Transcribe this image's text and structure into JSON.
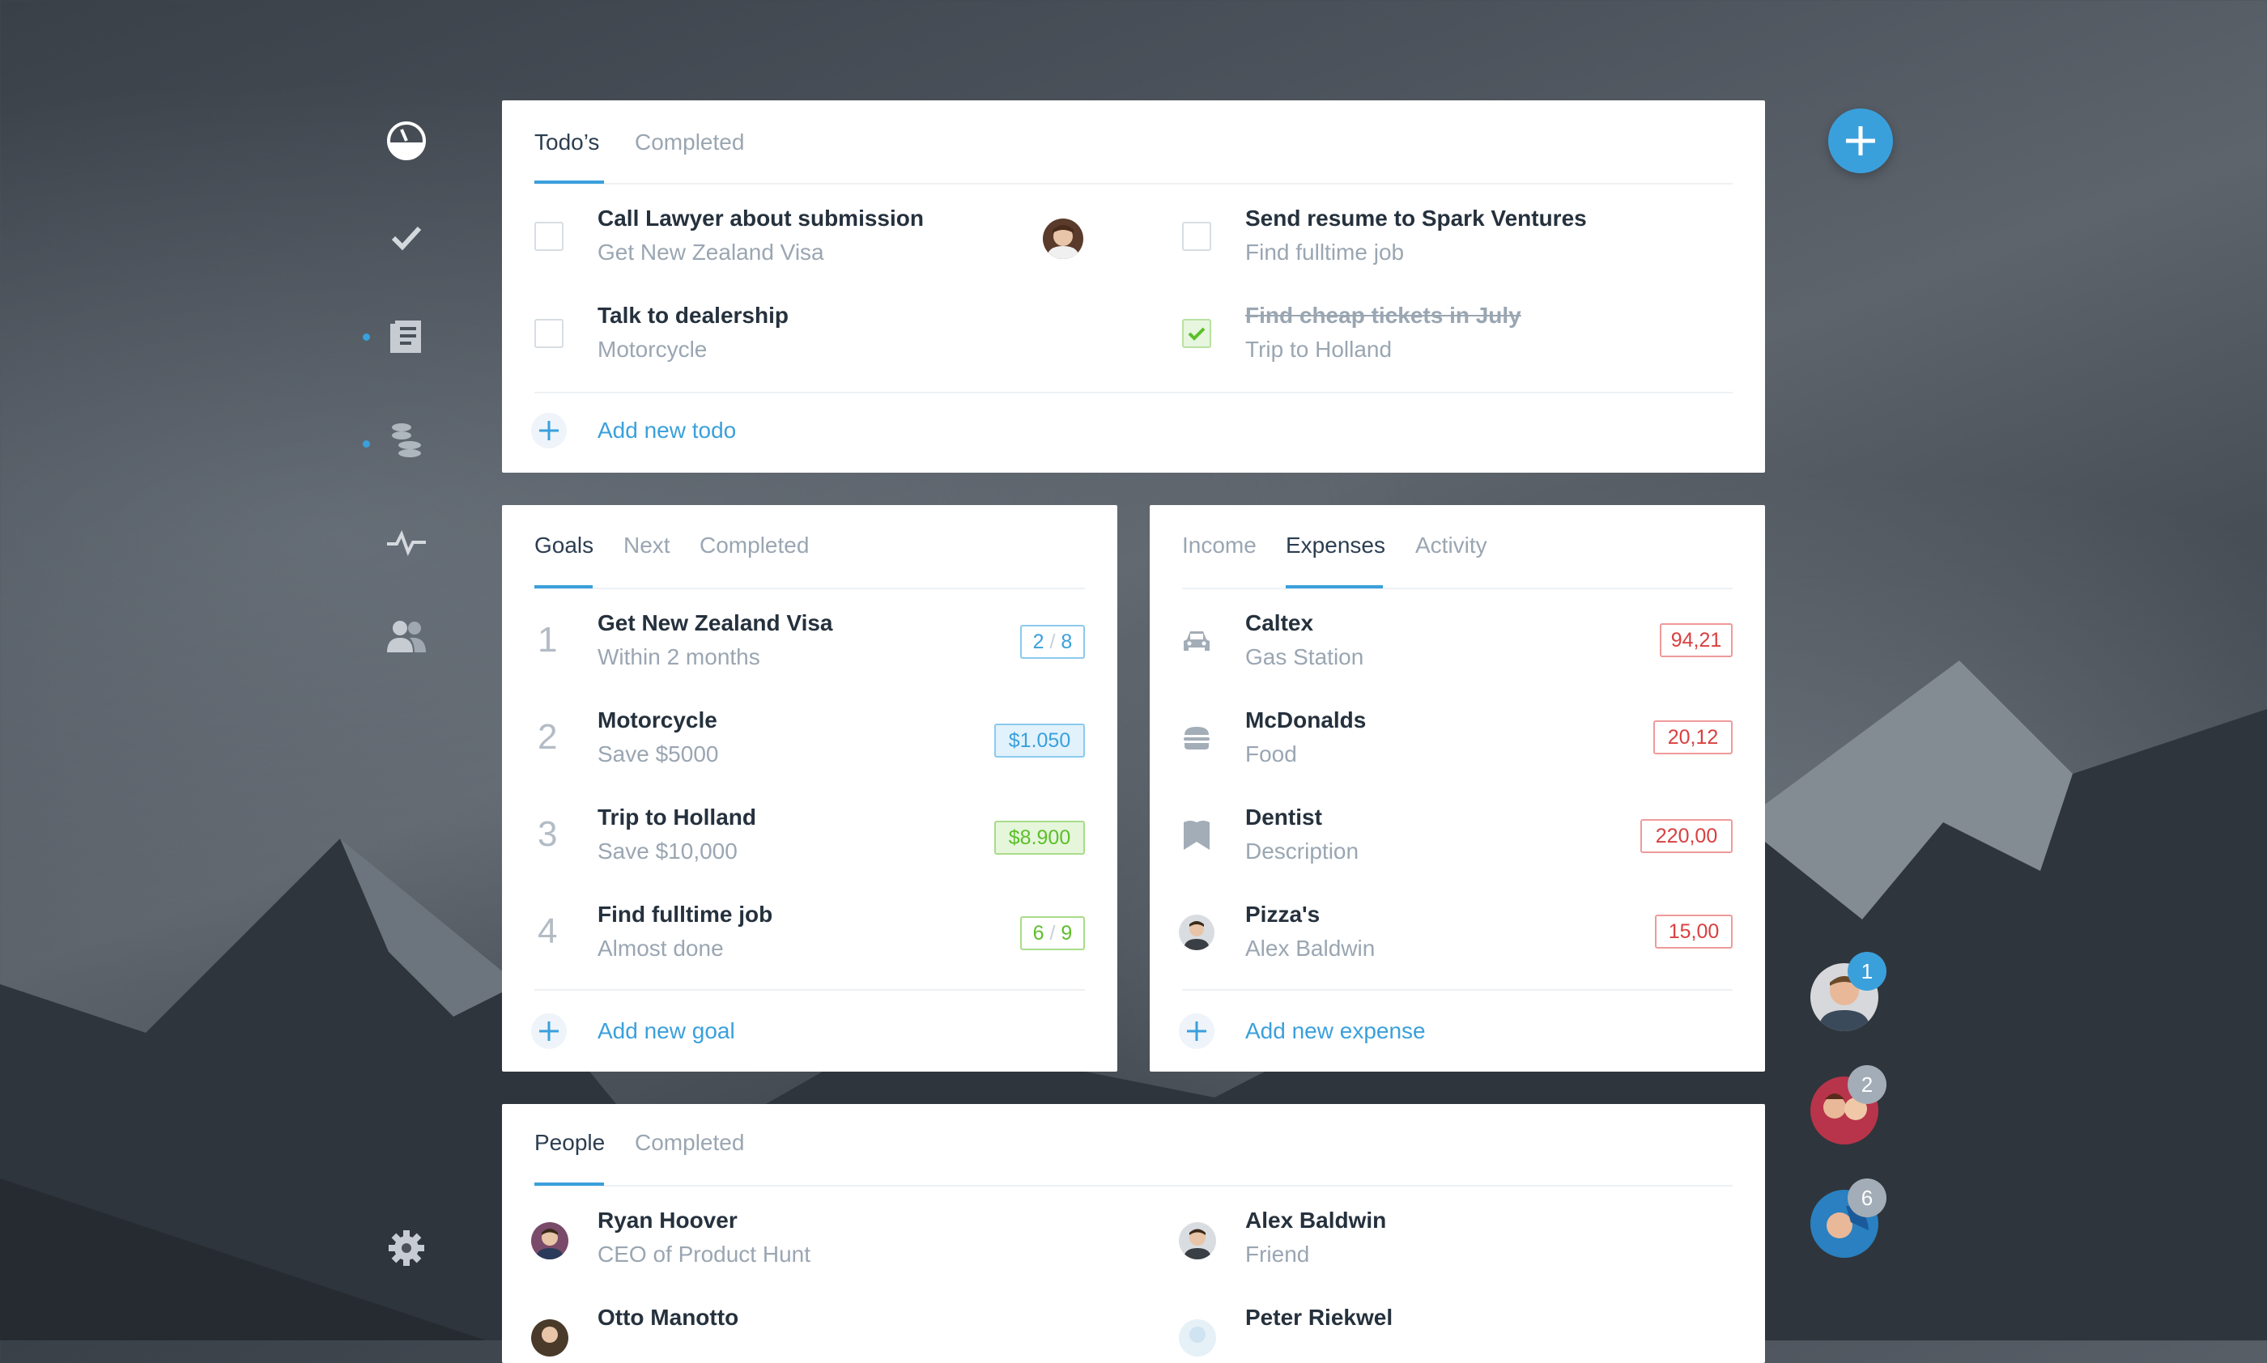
{
  "colors": {
    "accent": "#3aa0dc",
    "expense_red": "#d94040",
    "success_green": "#5cbf2a"
  },
  "sidebar": {
    "items": [
      {
        "icon": "dashboard-icon",
        "active": true
      },
      {
        "icon": "checkmark-icon"
      },
      {
        "icon": "document-icon",
        "has_dot": true
      },
      {
        "icon": "coins-icon",
        "has_dot": true
      },
      {
        "icon": "activity-icon"
      },
      {
        "icon": "people-icon"
      }
    ],
    "settings_icon": "gear-icon"
  },
  "todos": {
    "tabs": [
      "Todo’s",
      "Completed"
    ],
    "items": [
      {
        "title": "Call Lawyer about submission",
        "subtitle": "Get New Zealand Visa",
        "done": false,
        "has_avatar": true
      },
      {
        "title": "Send resume to Spark Ventures",
        "subtitle": "Find fulltime job",
        "done": false
      },
      {
        "title": "Talk to dealership",
        "subtitle": "Motorcycle",
        "done": false
      },
      {
        "title": "Find cheap tickets in July",
        "subtitle": "Trip to Holland",
        "done": true
      }
    ],
    "add_label": "Add new todo"
  },
  "goals": {
    "tabs": [
      "Goals",
      "Next",
      "Completed"
    ],
    "items": [
      {
        "num": "1",
        "title": "Get New Zealand Visa",
        "subtitle": "Within 2 months",
        "badge_a": "2",
        "badge_sep": "/",
        "badge_b": "8"
      },
      {
        "num": "2",
        "title": "Motorcycle",
        "subtitle": "Save $5000",
        "badge": "$1.050"
      },
      {
        "num": "3",
        "title": "Trip to Holland",
        "subtitle": "Save $10,000",
        "badge": "$8.900"
      },
      {
        "num": "4",
        "title": "Find fulltime job",
        "subtitle": "Almost done",
        "badge_a": "6",
        "badge_sep": "/",
        "badge_b": "9"
      }
    ],
    "add_label": "Add new goal"
  },
  "finance": {
    "tabs": [
      "Income",
      "Expenses",
      "Activity"
    ],
    "items": [
      {
        "icon": "car-icon",
        "title": "Caltex",
        "subtitle": "Gas Station",
        "amount": "94,21"
      },
      {
        "icon": "burger-icon",
        "title": "McDonalds",
        "subtitle": "Food",
        "amount": "20,12"
      },
      {
        "icon": "tooth-icon",
        "title": "Dentist",
        "subtitle": "Description",
        "amount": "220,00"
      },
      {
        "icon": "avatar",
        "title": "Pizza's",
        "subtitle": "Alex Baldwin",
        "amount": "15,00"
      }
    ],
    "add_label": "Add new expense"
  },
  "people": {
    "tabs": [
      "People",
      "Completed"
    ],
    "items": [
      {
        "name": "Ryan Hoover",
        "role": "CEO of Product Hunt"
      },
      {
        "name": "Alex Baldwin",
        "role": "Friend"
      },
      {
        "name": "Otto Manotto",
        "role": ""
      },
      {
        "name": "Peter Riekwel",
        "role": ""
      }
    ]
  },
  "chat_heads": [
    {
      "count": "1",
      "color": "#3aa0dc"
    },
    {
      "count": "2",
      "color": "#a3adb7"
    },
    {
      "count": "6",
      "color": "#a3adb7"
    }
  ]
}
